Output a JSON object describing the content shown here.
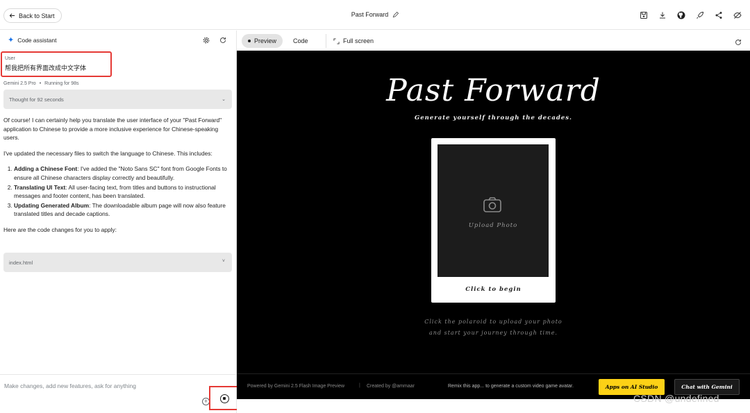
{
  "topbar": {
    "back_label": "Back to Start",
    "title": "Past Forward"
  },
  "left": {
    "assistant_label": "Code assistant",
    "user_label": "User",
    "user_message": "帮我把所有界面改成中文字体",
    "model_name": "Gemini 2.5 Pro",
    "run_status": "Running for 98s",
    "thought_label": "Thought for 92 seconds",
    "response_intro": "Of course! I can certainly help you translate the user interface of your \"Past Forward\" application to Chinese to provide a more inclusive experience for Chinese-speaking users.",
    "response_update": "I've updated the necessary files to switch the language to Chinese. This includes:",
    "items": [
      {
        "title": "Adding a Chinese Font",
        "text": ": I've added the \"Noto Sans SC\" font from Google Fonts to ensure all Chinese characters display correctly and beautifully."
      },
      {
        "title": "Translating UI Text",
        "text": ": All user-facing text, from titles and buttons to instructional messages and footer content, has been translated."
      },
      {
        "title": "Updating Generated Album",
        "text": ": The downloadable album page will now also feature translated titles and decade captions."
      }
    ],
    "response_outro": "Here are the code changes for you to apply:",
    "file_name": "index.html",
    "input_placeholder": "Make changes, add new features, ask for anything"
  },
  "right": {
    "tab_preview": "Preview",
    "tab_code": "Code",
    "tab_fullscreen": "Full screen"
  },
  "preview": {
    "title": "Past Forward",
    "subtitle": "Generate yourself through the decades.",
    "upload_label": "Upload Photo",
    "begin_label": "Click to begin",
    "hint": "Click the polaroid to upload your photo and start your journey through time.",
    "footer_powered": "Powered by Gemini 2.5 Flash Image Preview",
    "footer_sep": "|",
    "footer_created": "Created by @ammaar",
    "footer_remix": "Remix this app... to generate a custom video game avatar.",
    "btn_studio": "Apps on AI Studio",
    "btn_gemini": "Chat with Gemini"
  },
  "watermark": "CSDN @undefined"
}
